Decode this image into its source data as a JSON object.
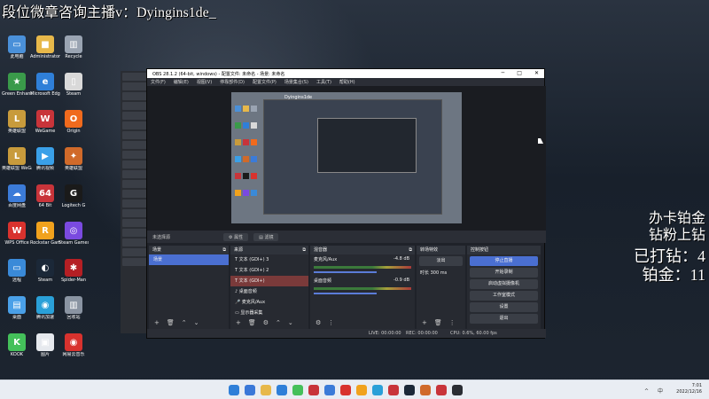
{
  "overlay": {
    "title": "段位微章咨询主播v：Dyingins1de_",
    "right_lines": [
      "办卡铂金",
      "钻粉上钻",
      "已打钻：4",
      "铂金：11"
    ]
  },
  "desktop_icons": [
    {
      "label": "此电脑",
      "color": "#4a90d9",
      "glyph": "▭"
    },
    {
      "label": "Administrator",
      "color": "#e7b84a",
      "glyph": "■"
    },
    {
      "label": "Recycle",
      "color": "#9aa4b2",
      "glyph": "▥"
    },
    {
      "label": "Green Enhanced",
      "color": "#3a9a4a",
      "glyph": "★"
    },
    {
      "label": "Microsoft Edge",
      "color": "#2f7fd8",
      "glyph": "e"
    },
    {
      "label": "Steam",
      "color": "#d9d9d9",
      "glyph": "▯"
    },
    {
      "label": "英雄联盟",
      "color": "#c89b3c",
      "glyph": "L"
    },
    {
      "label": "WeGame",
      "color": "#c8343a",
      "glyph": "W"
    },
    {
      "label": "Origin",
      "color": "#f06a1d",
      "glyph": "O"
    },
    {
      "label": "英雄联盟 WeGame",
      "color": "#c89b3c",
      "glyph": "L"
    },
    {
      "label": "腾讯视频",
      "color": "#3aa0e8",
      "glyph": "▶"
    },
    {
      "label": "英雄联盟",
      "color": "#d06a2a",
      "glyph": "✦"
    },
    {
      "label": "百度网盘",
      "color": "#3b7bd8",
      "glyph": "☁"
    },
    {
      "label": "64 Bit",
      "color": "#c8343a",
      "glyph": "64"
    },
    {
      "label": "Logitech G",
      "color": "#1a1a1a",
      "glyph": "G"
    },
    {
      "label": "WPS Office",
      "color": "#d8322e",
      "glyph": "W"
    },
    {
      "label": "Rockstar Games",
      "color": "#f1a21d",
      "glyph": "R"
    },
    {
      "label": "Steam Games",
      "color": "#7a4ae0",
      "glyph": "◎"
    },
    {
      "label": "远程",
      "color": "#3a8ad8",
      "glyph": "▭"
    },
    {
      "label": "Steam",
      "color": "#1b2838",
      "glyph": "◐"
    },
    {
      "label": "Spider-Man",
      "color": "#b51f24",
      "glyph": "✱"
    },
    {
      "label": "桌面",
      "color": "#4aa0e8",
      "glyph": "▤"
    },
    {
      "label": "腾讯加速",
      "color": "#2aa0d8",
      "glyph": "◉"
    },
    {
      "label": "回收站",
      "color": "#8a94a2",
      "glyph": "▥"
    },
    {
      "label": "KOOK",
      "color": "#44c05a",
      "glyph": "K"
    },
    {
      "label": "图片",
      "color": "#e6e9ee",
      "glyph": "▣"
    },
    {
      "label": "网易云音乐",
      "color": "#d8322e",
      "glyph": "◉"
    }
  ],
  "obs": {
    "title": "OBS 28.1.2 (64-bit, windows) - 配置文件: 未命名 - 场景: 未命名",
    "menu": [
      "文件(F)",
      "编辑(E)",
      "视图(V)",
      "停靠部件(D)",
      "配置文件(P)",
      "场景集合(S)",
      "工具(T)",
      "帮助(H)"
    ],
    "preview_title": "Dyingins1de",
    "no_source": "未选择源",
    "props_label": "属性",
    "filters_label": "滤镜",
    "docks": {
      "scenes": {
        "title": "场景",
        "items": [
          "场景"
        ]
      },
      "sources": {
        "title": "来源",
        "items": [
          "文本 (GDI+) 3",
          "文本 (GDI+) 2",
          "文本 (GDI+)",
          "桌面音频",
          "麦克风/Aux",
          "显示器采集"
        ]
      },
      "mixer": {
        "title": "混音器",
        "channels": [
          {
            "name": "麦克风/Aux",
            "db": "-4.8 dB"
          },
          {
            "name": "桌面音频",
            "db": "-0.9 dB"
          }
        ]
      },
      "transitions": {
        "title": "转场特效",
        "type": "淡出",
        "duration_label": "时长",
        "duration": "300 ms"
      },
      "controls": {
        "title": "控制按钮",
        "buttons": [
          "停止直播",
          "开始录制",
          "启动虚拟摄像机",
          "工作室模式",
          "设置",
          "退出"
        ]
      }
    },
    "status": {
      "live": "LIVE: 00:00:00",
      "rec": "REC: 00:00:00",
      "cpu": "CPU: 0.6%, 60.00 fps"
    }
  },
  "taskbar": {
    "time": "7:01",
    "date": "2022/12/16",
    "tray": "中"
  }
}
